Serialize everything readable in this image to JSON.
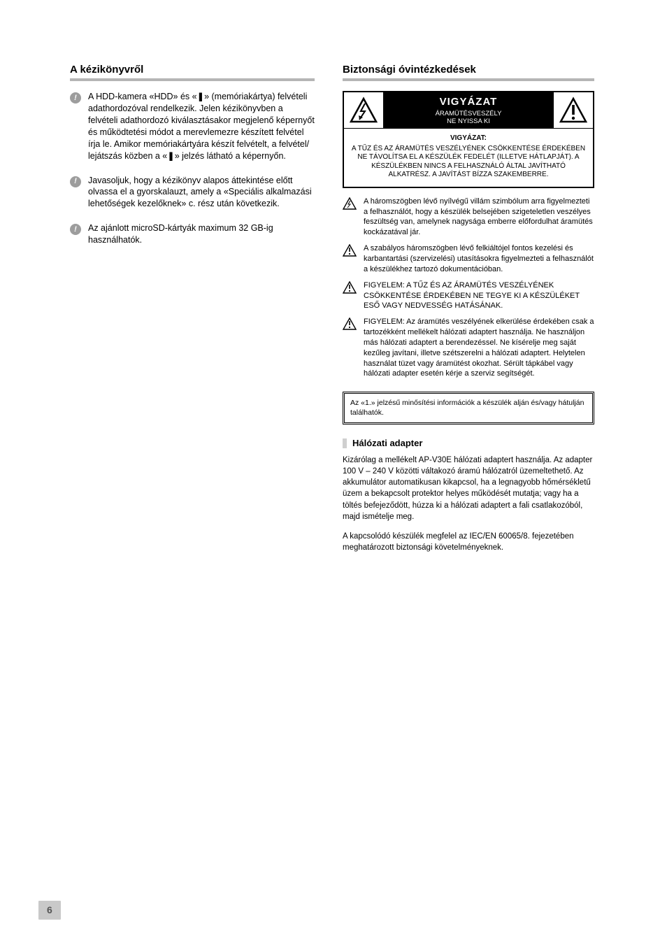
{
  "left": {
    "title": "A kézikönyvről",
    "notices": [
      "A HDD-kamera «HDD» és «❚» (memóriakártya) felvételi adathordozóval rendelkezik. Jelen kézikönyvben a felvételi adathordozó kiválasztásakor megjelenő képernyőt és működtetési módot a merevlemezre készített felvétel írja le. Amikor memóriakártyára készít felvételt, a felvétel/ lejátszás közben a «❚» jelzés látható a képernyőn.",
      "Javasoljuk, hogy a kézikönyv alapos áttekintése előtt olvassa el a gyorskalauzt, amely a «Speciális alkalmazási lehetőségek kezelőknek» c. rész után következik.",
      "Az ajánlott microSD-kártyák maximum 32 GB-ig használhatók."
    ]
  },
  "right": {
    "title": "Biztonsági óvintézkedések",
    "caution": {
      "big": "VIGYÁZAT",
      "smallTop": "ÁRAMÜTÉSVESZÉLY",
      "smallBottom": "NE NYISSA KI",
      "bodyBold": "VIGYÁZAT:",
      "body": "A TŰZ ÉS AZ ÁRAMÜTÉS VESZÉLYÉNEK CSÖKKENTÉSE ÉRDEKÉBEN NE TÁVOLÍTSA EL A KÉSZÜLÉK FEDELÉT (ILLETVE HÁTLAPJÁT). A KÉSZÜLÉKBEN NINCS A FELHASZNÁLÓ ÁLTAL JAVÍTHATÓ ALKATRÉSZ. A JAVÍTÁST BÍZZA SZAKEMBERRE."
    },
    "warns": [
      "A háromszögben lévő nyílvégű villám szimbólum arra figyelmezteti a felhasználót, hogy a készülék belsejében szigeteletlen veszélyes feszültség van, amelynek nagysága emberre előfordulhat áramütés kockázatával jár.",
      "A szabályos háromszögben lévő felkiáltójel fontos kezelési és karbantartási (szervizelési) utasításokra figyelmezteti a felhasználót a készülékhez tartozó dokumentációban.",
      "FIGYELEM: A TŰZ ÉS AZ ÁRAMÜTÉS VESZÉLYÉNEK CSÖKKENTÉSE ÉRDEKÉBEN NE TEGYE KI A KÉSZÜLÉKET ESŐ VAGY NEDVESSÉG HATÁSÁNAK.",
      "FIGYELEM: Az áramütés veszélyének elkerülése érdekében csak a tartozékként mellékelt hálózati adaptert használja. Ne használjon más hálózati adaptert a berendezéssel. Ne kísérelje meg saját kezűleg javítani, illetve szétszerelni a hálózati adaptert. Helytelen használat tüzet vagy áramütést okozhat. Sérült tápkábel vagy hálózati adapter esetén kérje a szerviz segítségét."
    ],
    "boxText": "Az «1.» jelzésű minősítési információk a készülék alján és/vagy hátulján találhatók.",
    "subhead": {
      "marker": "",
      "text": "Hálózati adapter"
    },
    "paras": [
      "Kizárólag a mellékelt AP-V30E hálózati adaptert használja. Az adapter 100 V – 240 V közötti váltakozó áramú hálózatról üzemeltethető. Az akkumulátor automatikusan kikapcsol, ha a legnagyobb hőmérsékletű üzem a bekapcsolt protektor helyes működését mutatja; vagy ha a töltés befejeződött, húzza ki a hálózati adaptert a fali csatlakozóból, majd ismételje meg.",
      "A kapcsolódó készülék megfelel az IEC/EN 60065/8. fejezetében meghatározott biztonsági követelményeknek."
    ]
  },
  "pageNumber": "6"
}
